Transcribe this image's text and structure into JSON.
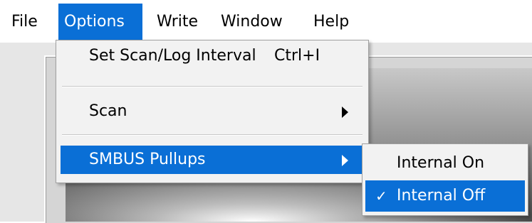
{
  "menubar": {
    "items": [
      {
        "label": "File"
      },
      {
        "label": "Options"
      },
      {
        "label": "Write"
      },
      {
        "label": "Window"
      },
      {
        "label": "Help"
      }
    ]
  },
  "options_menu": {
    "items": [
      {
        "label": "Set Scan/Log Interval",
        "shortcut": "Ctrl+I"
      },
      {
        "label": "Scan",
        "has_submenu": true
      },
      {
        "label": "SMBUS Pullups",
        "has_submenu": true,
        "highlighted": true
      }
    ]
  },
  "smbus_submenu": {
    "items": [
      {
        "label": "Internal On",
        "checked": false
      },
      {
        "label": "Internal Off",
        "checked": true,
        "check_mark": "✓",
        "highlighted": true
      }
    ]
  },
  "colors": {
    "highlight": "#0a6fd6",
    "menu_bg": "#f2f2f2"
  }
}
